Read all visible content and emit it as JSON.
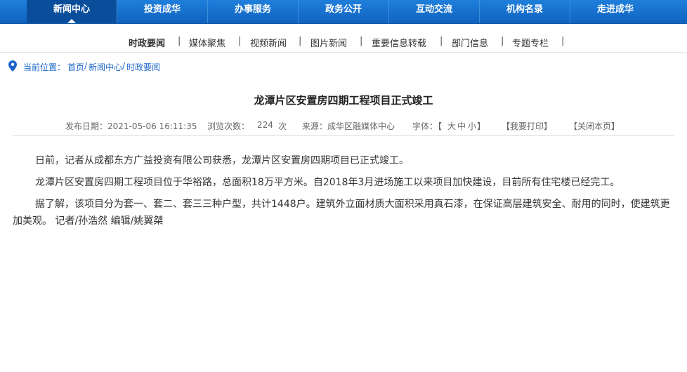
{
  "topnav": {
    "items": [
      {
        "label": "新闻中心"
      },
      {
        "label": "投资成华"
      },
      {
        "label": "办事服务"
      },
      {
        "label": "政务公开"
      },
      {
        "label": "互动交流"
      },
      {
        "label": "机构名录"
      },
      {
        "label": "走进成华"
      }
    ],
    "active_index": 0,
    "colors": {
      "bar": "#1573d3",
      "active": "#0a4e9b"
    }
  },
  "subnav": {
    "items": [
      {
        "label": "时政要闻"
      },
      {
        "label": "媒体聚焦"
      },
      {
        "label": "视频新闻"
      },
      {
        "label": "图片新闻"
      },
      {
        "label": "重要信息转载"
      },
      {
        "label": "部门信息"
      },
      {
        "label": "专题专栏"
      }
    ],
    "separator": "|",
    "current_index": 0
  },
  "breadcrumb": {
    "icon": "location-pin-icon",
    "label": "当前位置：",
    "path": [
      "首页",
      "新闻中心",
      "时政要闻"
    ],
    "separator": "/",
    "color": "#1b66c9"
  },
  "article": {
    "title": "龙潭片区安置房四期工程项目正式竣工",
    "meta": {
      "date": "发布日期：2021-05-06 16:11:35",
      "views_label": "浏览次数：",
      "views_value": "224",
      "views_unit": "次",
      "source": "来源：成华区融媒体中心",
      "font_label": "字体：【",
      "font_large": "大",
      "font_medium": "中",
      "font_small": "小",
      "font_close": "】",
      "print": "【我要打印】",
      "close": "【关闭本页】"
    },
    "paragraphs": [
      "日前，记者从成都东方广益投资有限公司获悉，龙潭片区安置房四期项目已正式竣工。",
      "龙潭片区安置房四期工程项目位于华裕路，总面积18万平方米。自2018年3月进场施工以来项目加快建设，目前所有住宅楼已经完工。",
      "据了解，该项目分为套一、套二、套三三种户型，共计1448户。建筑外立面材质大面积采用真石漆，在保证高层建筑安全、耐用的同时，使建筑更加美观。 记者/孙浩然 编辑/姚翼桀"
    ]
  }
}
